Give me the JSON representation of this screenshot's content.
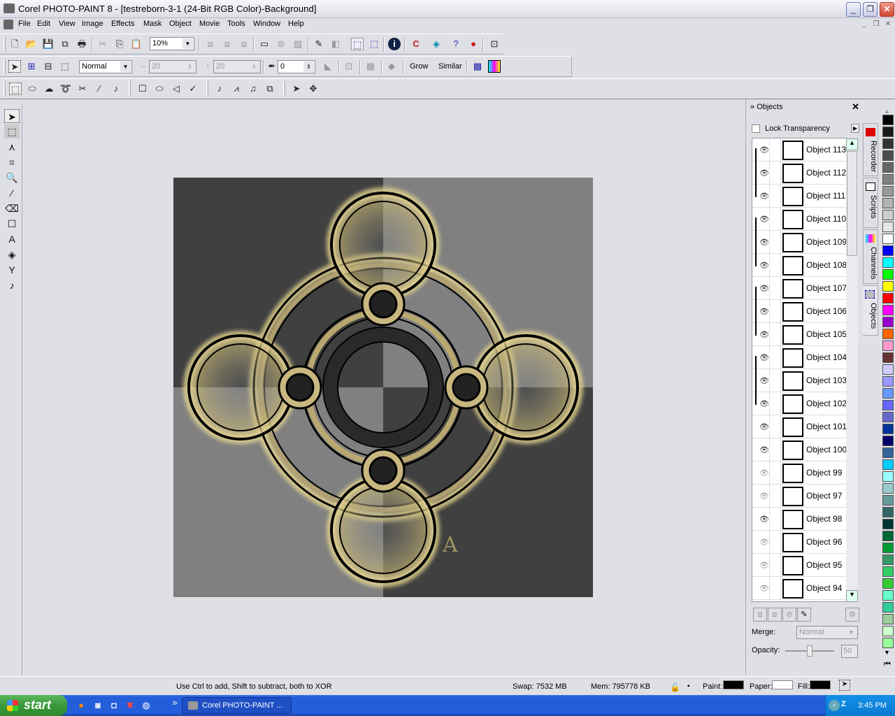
{
  "window": {
    "title": "Corel PHOTO-PAINT 8 - [testreborn-3-1  (24-Bit RGB Color)-Background]",
    "controls": [
      "minimize",
      "restore",
      "close"
    ]
  },
  "menubar": [
    "File",
    "Edit",
    "View",
    "Image",
    "Effects",
    "Mask",
    "Object",
    "Movie",
    "Tools",
    "Window",
    "Help"
  ],
  "toolbar_standard": {
    "zoom_value": "10%"
  },
  "toolbar_mask": {
    "mode_value": "Normal",
    "width_value": "20",
    "height_value": "20",
    "feather_value": "0",
    "grow_label": "Grow",
    "similar_label": "Similar"
  },
  "docker": {
    "title": "Objects",
    "lock_transparency_label": "Lock Transparency",
    "lock_transparency_checked": false,
    "objects": [
      {
        "name": "Object 113",
        "visible": true
      },
      {
        "name": "Object 112",
        "visible": true
      },
      {
        "name": "Object 111",
        "visible": true
      },
      {
        "name": "Object 110",
        "visible": true
      },
      {
        "name": "Object 109",
        "visible": true
      },
      {
        "name": "Object 108",
        "visible": true
      },
      {
        "name": "Object 107",
        "visible": true
      },
      {
        "name": "Object 106",
        "visible": true
      },
      {
        "name": "Object 105",
        "visible": true
      },
      {
        "name": "Object 104",
        "visible": true
      },
      {
        "name": "Object 103",
        "visible": true
      },
      {
        "name": "Object 102",
        "visible": true
      },
      {
        "name": "Object 101",
        "visible": true
      },
      {
        "name": "Object 100",
        "visible": true
      },
      {
        "name": "Object 99",
        "visible": false
      },
      {
        "name": "Object 97",
        "visible": false
      },
      {
        "name": "Object 98",
        "visible": true
      },
      {
        "name": "Object 96",
        "visible": false
      },
      {
        "name": "Object 95",
        "visible": false
      },
      {
        "name": "Object 94",
        "visible": false
      }
    ],
    "merge_label": "Merge:",
    "merge_value": "Normal",
    "opacity_label": "Opacity:",
    "opacity_value": "50",
    "side_tabs": [
      "Recorder",
      "Scripts",
      "Channels",
      "Objects"
    ]
  },
  "palette": [
    "#000000",
    "#1a1a1a",
    "#333333",
    "#4d4d4d",
    "#666666",
    "#808080",
    "#999999",
    "#b3b3b3",
    "#cccccc",
    "#e6e6e6",
    "#ffffff",
    "#0000ff",
    "#00ffff",
    "#00ff00",
    "#ffff00",
    "#ff0000",
    "#ff00ff",
    "#9900cc",
    "#ff6600",
    "#ff99cc",
    "#663333",
    "#ccccff",
    "#9999ff",
    "#6699ff",
    "#6666ff",
    "#6666cc",
    "#003399",
    "#000066",
    "#336699",
    "#00ccff",
    "#99ffff",
    "#99cccc",
    "#669999",
    "#336666",
    "#003333",
    "#006633",
    "#009933",
    "#339966",
    "#33cc66",
    "#33cc33",
    "#66ffcc",
    "#33cc99",
    "#99cc99",
    "#ccffcc",
    "#99ff99"
  ],
  "status": {
    "hint": "Use Ctrl to add, Shift to subtract, both to XOR",
    "swap": "Swap: 7532 MB",
    "mem": "Mem: 795778 KB",
    "paint_label": "Paint:",
    "paper_label": "Paper:",
    "fill_label": "Fill:",
    "paint_color": "#000000",
    "paper_color": "#ffffff",
    "fill_color": "#000000"
  },
  "taskbar": {
    "start_label": "start",
    "task_label": "Corel PHOTO-PAINT ...",
    "clock": "3:45 PM"
  }
}
